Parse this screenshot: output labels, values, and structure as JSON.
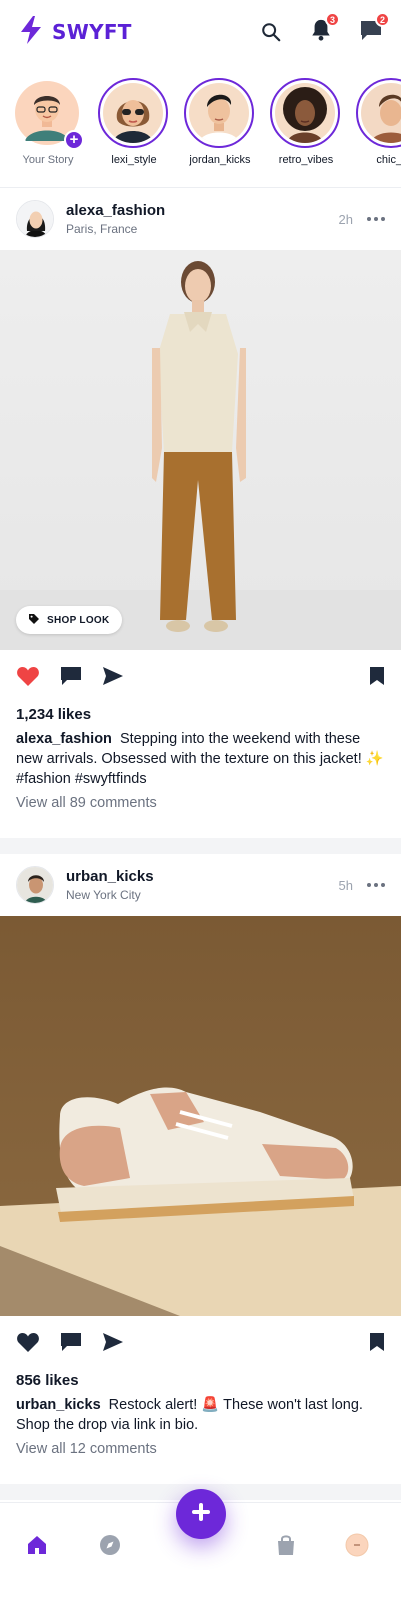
{
  "app": {
    "brand": "SWYFT"
  },
  "header": {
    "notifications_count": "3",
    "messages_count": "2"
  },
  "stories": [
    {
      "label": "Your Story",
      "own": true
    },
    {
      "label": "lexi_style"
    },
    {
      "label": "jordan_kicks"
    },
    {
      "label": "retro_vibes"
    },
    {
      "label": "chic_fi"
    }
  ],
  "posts": [
    {
      "username": "alexa_fashion",
      "location": "Paris, France",
      "time": "2h",
      "shop_label": "SHOP LOOK",
      "likes": "1,234 likes",
      "caption_user": "alexa_fashion",
      "caption_text": "Stepping into the weekend with these new arrivals. Obsessed with the texture on this jacket! ✨ #fashion #swyftfinds",
      "comments": "View all 89 comments",
      "liked": true
    },
    {
      "username": "urban_kicks",
      "location": "New York City",
      "time": "5h",
      "likes": "856 likes",
      "caption_user": "urban_kicks",
      "caption_text": "Restock alert! 🚨 These won't last long. Shop the drop via link in bio.",
      "comments": "View all 12 comments",
      "liked": false
    }
  ],
  "colors": {
    "accent": "#6d28d9",
    "badge": "#ef4444",
    "like": "#ef4444"
  },
  "icons": [
    "bolt-icon",
    "search-icon",
    "bell-icon",
    "chat-icon",
    "tag-icon",
    "heart-icon",
    "comment-icon",
    "send-icon",
    "bookmark-icon",
    "home-icon",
    "compass-icon",
    "plus-icon",
    "shopping-bag-icon"
  ]
}
